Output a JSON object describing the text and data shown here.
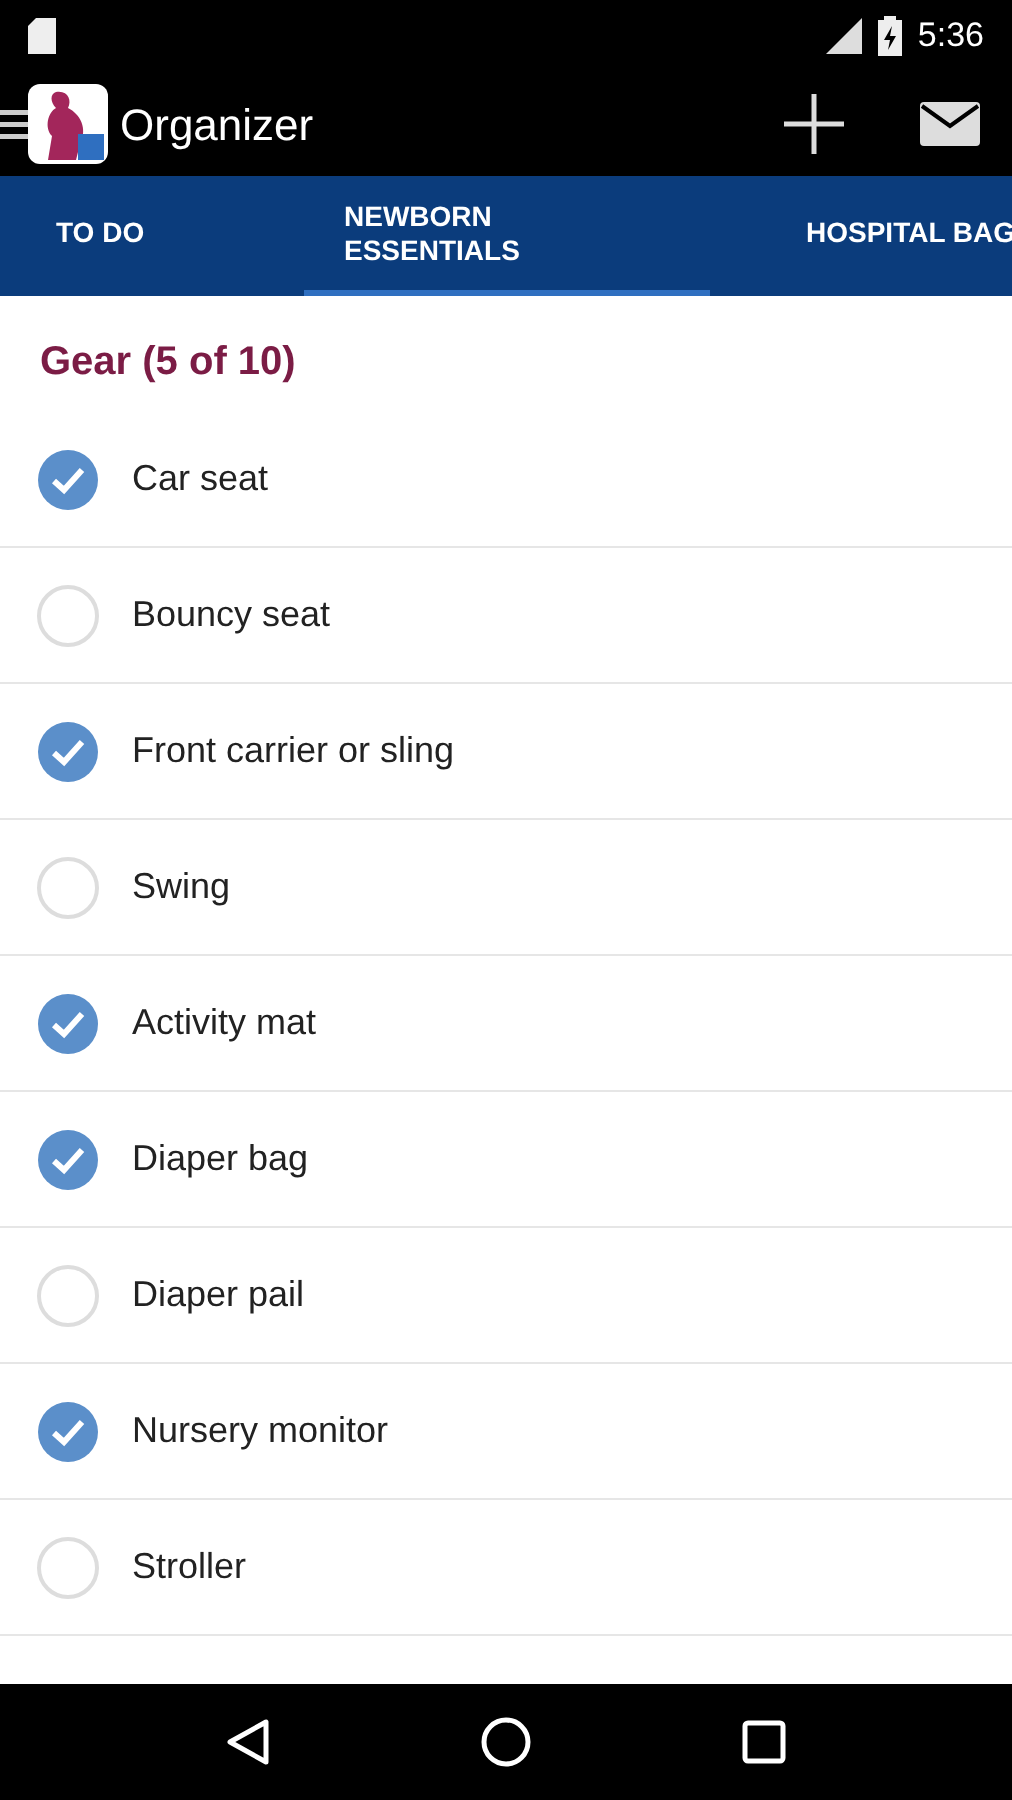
{
  "status_bar": {
    "time": "5:36"
  },
  "toolbar": {
    "title": "Organizer"
  },
  "tabs": [
    {
      "label": "TO DO",
      "selected": false
    },
    {
      "label": "NEWBORN ESSENTIALS",
      "selected": true
    },
    {
      "label": "HOSPITAL BAG",
      "selected": false
    }
  ],
  "section": {
    "title": "Gear (5 of 10)"
  },
  "items": [
    {
      "label": "Car seat",
      "checked": true
    },
    {
      "label": "Bouncy seat",
      "checked": false
    },
    {
      "label": "Front carrier or sling",
      "checked": true
    },
    {
      "label": "Swing",
      "checked": false
    },
    {
      "label": "Activity mat",
      "checked": true
    },
    {
      "label": "Diaper bag",
      "checked": true
    },
    {
      "label": "Diaper pail",
      "checked": false
    },
    {
      "label": "Nursery monitor",
      "checked": true
    },
    {
      "label": "Stroller",
      "checked": false
    }
  ]
}
